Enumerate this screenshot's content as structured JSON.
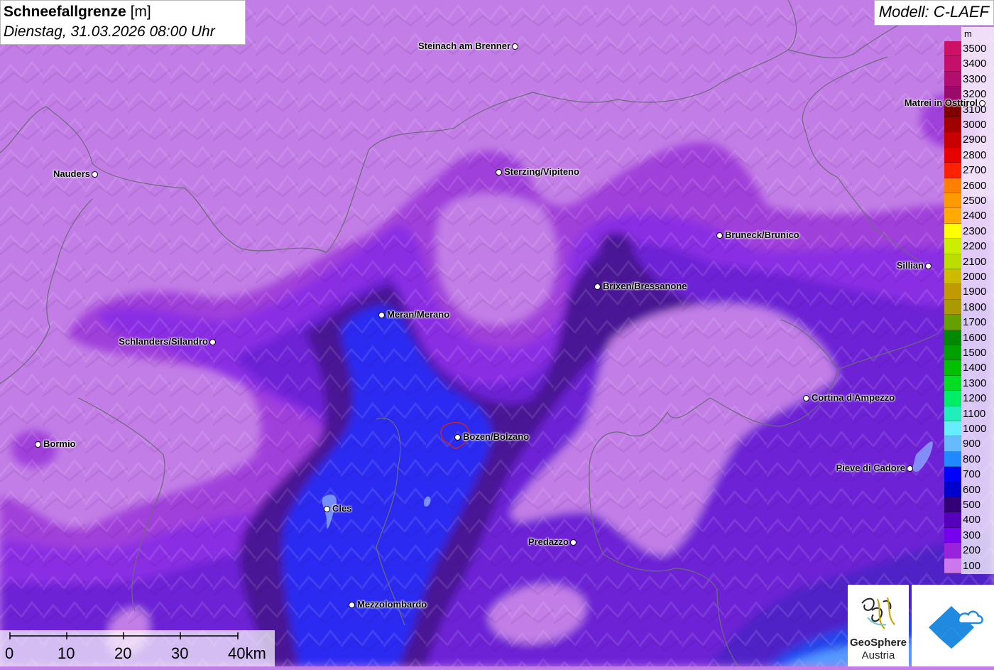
{
  "header": {
    "title": "Schneefallgrenze",
    "title_unit": "[m]",
    "datetime": "Dienstag, 31.03.2026 08:00 Uhr",
    "model": "Modell: C-LAEF"
  },
  "legend": {
    "unit": "m",
    "entries": [
      {
        "label": "3500",
        "color": "#cc1166"
      },
      {
        "label": "3400",
        "color": "#c4106a"
      },
      {
        "label": "3300",
        "color": "#b20e6e"
      },
      {
        "label": "3200",
        "color": "#990a6a"
      },
      {
        "label": "3100",
        "color": "#800000"
      },
      {
        "label": "3000",
        "color": "#a00000"
      },
      {
        "label": "2900",
        "color": "#c80000"
      },
      {
        "label": "2800",
        "color": "#e60000"
      },
      {
        "label": "2700",
        "color": "#ff2200"
      },
      {
        "label": "2600",
        "color": "#ff8000"
      },
      {
        "label": "2500",
        "color": "#ff9900"
      },
      {
        "label": "2400",
        "color": "#ffaa00"
      },
      {
        "label": "2300",
        "color": "#ffff00"
      },
      {
        "label": "2200",
        "color": "#ccee00"
      },
      {
        "label": "2100",
        "color": "#bbdd00"
      },
      {
        "label": "2000",
        "color": "#ccbb00"
      },
      {
        "label": "1900",
        "color": "#c09a00"
      },
      {
        "label": "1800",
        "color": "#a89a00"
      },
      {
        "label": "1700",
        "color": "#66a000"
      },
      {
        "label": "1600",
        "color": "#008800"
      },
      {
        "label": "1500",
        "color": "#00a000"
      },
      {
        "label": "1400",
        "color": "#00c000"
      },
      {
        "label": "1300",
        "color": "#00dd22"
      },
      {
        "label": "1200",
        "color": "#00ee66"
      },
      {
        "label": "1100",
        "color": "#22eebb"
      },
      {
        "label": "1000",
        "color": "#66eeff"
      },
      {
        "label": "900",
        "color": "#66bbff"
      },
      {
        "label": "800",
        "color": "#2288ff"
      },
      {
        "label": "700",
        "color": "#0000ff"
      },
      {
        "label": "600",
        "color": "#0000cc"
      },
      {
        "label": "500",
        "color": "#330077"
      },
      {
        "label": "400",
        "color": "#5500bb"
      },
      {
        "label": "300",
        "color": "#7700ee"
      },
      {
        "label": "200",
        "color": "#9922dd"
      },
      {
        "label": "100",
        "color": "#cc77ee"
      }
    ]
  },
  "cities": [
    {
      "name": "Steinach am Brenner",
      "side": "left"
    },
    {
      "name": "Matrei in Osttirol",
      "side": "left"
    },
    {
      "name": "Nauders",
      "side": "left"
    },
    {
      "name": "Sterzing/Vipiteno",
      "side": "right"
    },
    {
      "name": "Bruneck/Brunico",
      "side": "right"
    },
    {
      "name": "Sillian",
      "side": "left"
    },
    {
      "name": "Brixen/Bressanone",
      "side": "right"
    },
    {
      "name": "Meran/Merano",
      "side": "right"
    },
    {
      "name": "Schlanders/Silandro",
      "side": "left"
    },
    {
      "name": "Cortina d'Ampezzo",
      "side": "right"
    },
    {
      "name": "Bormio",
      "side": "right"
    },
    {
      "name": "Bozen/Bolzano",
      "side": "right"
    },
    {
      "name": "Pieve di Cadore",
      "side": "left"
    },
    {
      "name": "Cles",
      "side": "right"
    },
    {
      "name": "Predazzo",
      "side": "left"
    },
    {
      "name": "Mezzolombardo",
      "side": "right"
    }
  ],
  "scale": {
    "ticks": [
      "0",
      "10",
      "20",
      "30",
      "40km"
    ]
  },
  "logo": {
    "line1": "GeoSphere",
    "line2": "Austria"
  }
}
